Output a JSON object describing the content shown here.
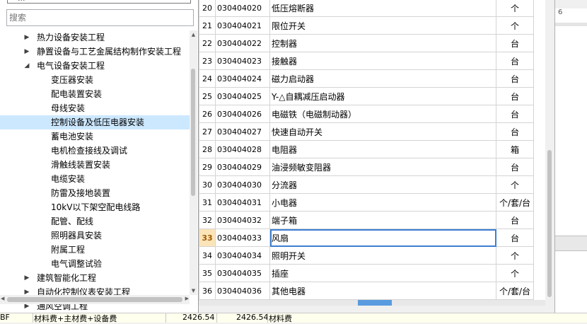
{
  "left_panel": {
    "top_sliver_text": "...",
    "search": {
      "placeholder": "搜索",
      "value": ""
    },
    "tree": [
      {
        "label": "热力设备安装工程",
        "level": 1,
        "expanded": false
      },
      {
        "label": "静置设备与工艺金属结构制作安装工程",
        "level": 1,
        "expanded": false
      },
      {
        "label": "电气设备安装工程",
        "level": 1,
        "expanded": true
      },
      {
        "label": "变压器安装",
        "level": 2
      },
      {
        "label": "配电装置安装",
        "level": 2
      },
      {
        "label": "母线安装",
        "level": 2
      },
      {
        "label": "控制设备及低压电器安装",
        "level": 2,
        "selected": true
      },
      {
        "label": "蓄电池安装",
        "level": 2
      },
      {
        "label": "电机检查接线及调试",
        "level": 2
      },
      {
        "label": "滑触线装置安装",
        "level": 2
      },
      {
        "label": "电缆安装",
        "level": 2
      },
      {
        "label": "防雷及接地装置",
        "level": 2
      },
      {
        "label": "10kV以下架空配电线路",
        "level": 2
      },
      {
        "label": "配管、配线",
        "level": 2
      },
      {
        "label": "照明器具安装",
        "level": 2
      },
      {
        "label": "附属工程",
        "level": 2
      },
      {
        "label": "电气调整试验",
        "level": 2
      },
      {
        "label": "建筑智能化工程",
        "level": 1,
        "expanded": false
      },
      {
        "label": "自动化控制仪表安装工程",
        "level": 1,
        "expanded": false
      },
      {
        "label": "通风空调工程",
        "level": 1,
        "expanded": false
      }
    ]
  },
  "table": {
    "current_row": "33",
    "rows": [
      {
        "idx": "20",
        "code": "030404020",
        "name": "低压熔断器",
        "unit": "个"
      },
      {
        "idx": "21",
        "code": "030404021",
        "name": "限位开关",
        "unit": "个"
      },
      {
        "idx": "22",
        "code": "030404022",
        "name": "控制器",
        "unit": "台"
      },
      {
        "idx": "23",
        "code": "030404023",
        "name": "接触器",
        "unit": "台"
      },
      {
        "idx": "24",
        "code": "030404024",
        "name": "磁力启动器",
        "unit": "台"
      },
      {
        "idx": "25",
        "code": "030404025",
        "name": "Y-△自耦减压启动器",
        "unit": "台"
      },
      {
        "idx": "26",
        "code": "030404026",
        "name": "电磁铁（电磁制动器）",
        "unit": "台"
      },
      {
        "idx": "27",
        "code": "030404027",
        "name": "快速自动开关",
        "unit": "台"
      },
      {
        "idx": "28",
        "code": "030404028",
        "name": "电阻器",
        "unit": "箱"
      },
      {
        "idx": "29",
        "code": "030404029",
        "name": "油浸频敏变阻器",
        "unit": "台"
      },
      {
        "idx": "30",
        "code": "030404030",
        "name": "分流器",
        "unit": "个"
      },
      {
        "idx": "31",
        "code": "030404031",
        "name": "小电器",
        "unit": "个/套/台"
      },
      {
        "idx": "32",
        "code": "030404032",
        "name": "端子箱",
        "unit": "台"
      },
      {
        "idx": "33",
        "code": "030404033",
        "name": "风扇",
        "unit": "台"
      },
      {
        "idx": "34",
        "code": "030404034",
        "name": "照明开关",
        "unit": "个"
      },
      {
        "idx": "35",
        "code": "030404035",
        "name": "插座",
        "unit": "个"
      },
      {
        "idx": "36",
        "code": "030404036",
        "name": "其他电器",
        "unit": "个/套/台"
      }
    ]
  },
  "background": {
    "right_sliver_text": "6",
    "bottom_strip": {
      "col1": "BF",
      "col2": "材料费+主材费+设备费",
      "col3": "2426.54",
      "col4": "2426.54",
      "col5": "材料费"
    }
  },
  "colors": {
    "selection": "#cce8ff",
    "current_row_header": "#fbe4b8",
    "cell_focus_border": "#3c7fd0",
    "scroll_grip": "#5a9be0"
  }
}
